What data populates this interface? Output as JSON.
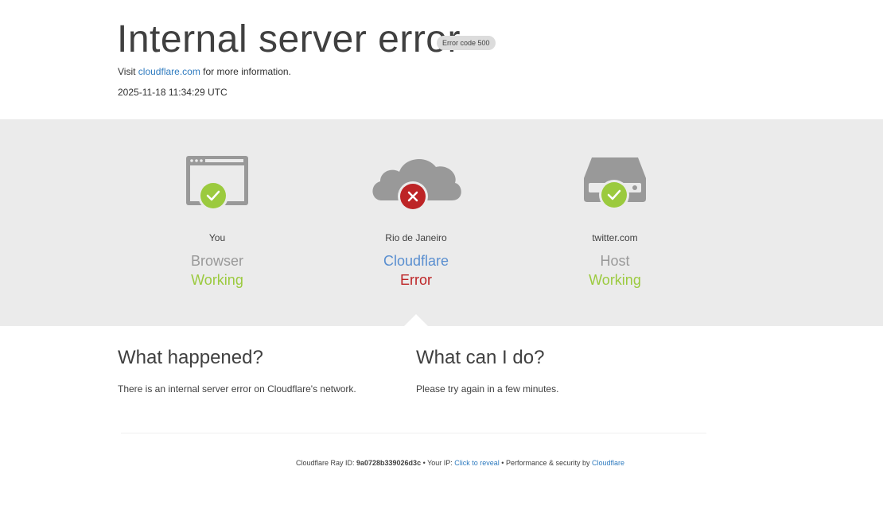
{
  "header": {
    "title": "Internal server error",
    "error_badge": "Error code 500",
    "visit_prefix": "Visit ",
    "visit_link": "cloudflare.com",
    "visit_suffix": " for more information.",
    "timestamp": "2025-11-18 11:34:29 UTC"
  },
  "status": {
    "browser": {
      "location": "You",
      "role": "Browser",
      "state": "Working",
      "icon": "browser-window-icon",
      "badge": "check-icon"
    },
    "cloudflare": {
      "location": "Rio de Janeiro",
      "role": "Cloudflare",
      "state": "Error",
      "icon": "cloud-icon",
      "badge": "x-icon"
    },
    "host": {
      "location": "twitter.com",
      "role": "Host",
      "state": "Working",
      "icon": "server-icon",
      "badge": "check-icon"
    }
  },
  "what_happened": {
    "heading": "What happened?",
    "text": "There is an internal server error on Cloudflare's network."
  },
  "what_can_i_do": {
    "heading": "What can I do?",
    "text": "Please try again in a few minutes."
  },
  "footer": {
    "ray_label": "Cloudflare Ray ID: ",
    "ray_id": "9a0728b339026d3c",
    "sep1": " • Your IP: ",
    "reveal_link": "Click to reveal",
    "sep2": " • Performance & security by ",
    "cf_link": "Cloudflare"
  },
  "colors": {
    "ok_green": "#9bca3e",
    "error_red": "#bd2426",
    "link_blue": "#2f7bbf",
    "band_gray": "#ebebeb",
    "icon_gray": "#999999"
  }
}
